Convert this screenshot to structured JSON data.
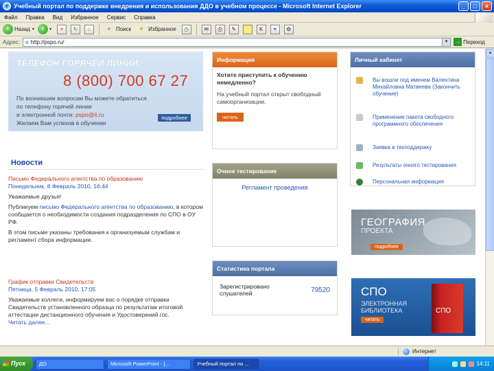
{
  "window": {
    "title": "Учебный портал по поддержке внедрения и использования ДДО в учебном процессе - Microsoft Internet Explorer"
  },
  "menu": [
    "Файл",
    "Правка",
    "Вид",
    "Избранное",
    "Сервис",
    "Справка"
  ],
  "toolbar": {
    "back_label": "Назад",
    "search_label": "Поиск",
    "favorites_label": "Избранное"
  },
  "address": {
    "label": "Адрес:",
    "url": "http://pspo.ru/",
    "go_label": "Переход"
  },
  "hotline": {
    "title": "ТЕЛЕФОН ГОРЯЧЕЙ ЛИНИИ:",
    "phone": "8 (800) 700 67 27",
    "text1": "По возникшим вопросам Вы можете обратиться по телефону горячей линии",
    "text2": "и электронной почте: ",
    "email": "pspo@it.ru",
    "text3": "Желаем Вам успехов в обучении",
    "more": "подробнее"
  },
  "news": {
    "title": "Новости",
    "item1": {
      "head": "Письмо Федерального агентства по образованию",
      "date": "Понедельник, 8 Февраль 2010, 16:44",
      "greet": "Уважаемые друзья!",
      "p1a": "Публикуем ",
      "p1link": "письмо Федерального агентства по образованию",
      "p1b": ", в котором сообщается о необходимости создания подразделения по СПО в ОУ РФ.",
      "p2": "В этом письме указаны требования к организуемым службам и регламент сбора информации."
    },
    "item2": {
      "head": "График отправки Свидетельств",
      "date": "Пятница, 5 Февраль 2010, 17:05",
      "p1": "Уважаемые коллеги, информируем вас о порядке отправки Свидетельств установленного образца по результатам итоговой аттестации дистанционного обучения и Удостоверений гос.",
      "more": "Читать далее..."
    }
  },
  "info_panel": {
    "title": "Информация",
    "question": "Хотите приступить к обучению немедленно?",
    "text": "На учебный портал открыт свободный самоорганизации.",
    "read": "читать"
  },
  "test_panel": {
    "title": "Очное тестирование",
    "link": "Регламент проведения"
  },
  "stat_panel": {
    "title": "Статистика портала",
    "label": "Зарегистрировано слушателей",
    "value": "79520"
  },
  "cabinet": {
    "title": "Личный кабинет",
    "items": [
      "Вы вошли под именем Валентина Михайловна Матвеева (Закончить обучение)",
      "Применение пакета свободного программного обеспечения",
      "Заявка в техподдержку",
      "Результаты очного тестирования",
      "Персональная информация"
    ]
  },
  "banner_geo": {
    "title": "ГЕОГРАФИЯ",
    "subtitle": "ПРОЕКТА",
    "button": "подробнее"
  },
  "banner_spo": {
    "title": "СПО",
    "line1": "ЭЛЕКТРОННАЯ",
    "line2": "БИБЛИОТЕКА",
    "button": "читать",
    "book": "СПО"
  },
  "statusbar": {
    "zone": "Интернет"
  },
  "taskbar": {
    "start": "Пуск",
    "tasks": [
      "ДО",
      "Microsoft PowerPoint - [...",
      "Учебный портал по ..."
    ],
    "time": "14:11"
  }
}
